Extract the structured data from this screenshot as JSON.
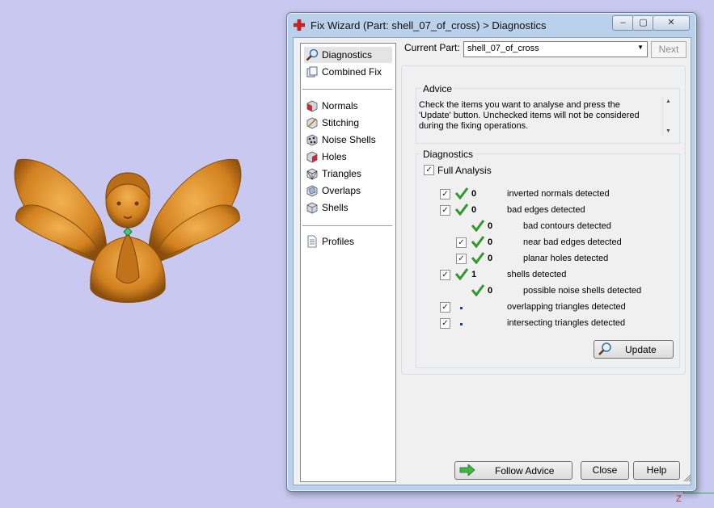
{
  "window": {
    "title": "Fix Wizard (Part: shell_07_of_cross) > Diagnostics",
    "caption_buttons": {
      "minimize": "‒",
      "maximize": "▢",
      "close": "✕"
    }
  },
  "nav": {
    "items_top": [
      "Diagnostics",
      "Combined Fix"
    ],
    "items_mid": [
      "Normals",
      "Stitching",
      "Noise Shells",
      "Holes",
      "Triangles",
      "Overlaps",
      "Shells"
    ],
    "items_bottom": [
      "Profiles"
    ],
    "selected": "Diagnostics"
  },
  "header": {
    "current_part_label": "Current Part:",
    "current_part_value": "shell_07_of_cross",
    "next_label": "Next"
  },
  "advice": {
    "legend": "Advice",
    "text": "Check the items you want to analyse and press the 'Update' button. Unchecked items will not be considered during the fixing operations."
  },
  "diagnostics": {
    "legend": "Diagnostics",
    "full_analysis_label": "Full Analysis",
    "full_analysis_checked": true,
    "rows": [
      {
        "checked": true,
        "status": "ok",
        "count": "0",
        "label": "inverted normals detected"
      },
      {
        "checked": true,
        "status": "ok",
        "count": "0",
        "label": "bad edges detected"
      },
      {
        "checked": null,
        "status": "ok",
        "count": "0",
        "label": "bad contours detected"
      },
      {
        "checked": true,
        "status": "ok",
        "count": "0",
        "label": "near bad edges detected"
      },
      {
        "checked": true,
        "status": "ok",
        "count": "0",
        "label": "planar holes detected"
      },
      {
        "checked": true,
        "status": "ok",
        "count": "1",
        "label": "shells detected"
      },
      {
        "checked": null,
        "status": "ok",
        "count": "0",
        "label": "possible noise shells detected"
      },
      {
        "checked": true,
        "status": "none",
        "count": "",
        "label": "overlapping triangles detected"
      },
      {
        "checked": true,
        "status": "none",
        "count": "",
        "label": "intersecting triangles detected"
      }
    ],
    "update_label": "Update"
  },
  "footer": {
    "follow_advice_label": "Follow Advice",
    "close_label": "Close",
    "help_label": "Help"
  },
  "viewport": {
    "axis_label": "Z"
  },
  "colors": {
    "background": "#c8c8f0",
    "model": "#d9892a",
    "check_green": "#2e9a2e",
    "title_icon_red": "#d62020"
  }
}
